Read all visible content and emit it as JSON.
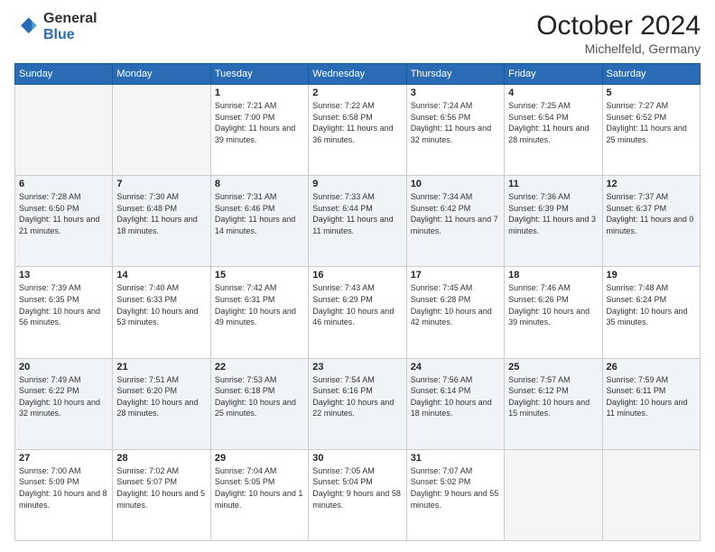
{
  "header": {
    "logo_line1": "General",
    "logo_line2": "Blue",
    "month": "October 2024",
    "location": "Michelfeld, Germany"
  },
  "days_of_week": [
    "Sunday",
    "Monday",
    "Tuesday",
    "Wednesday",
    "Thursday",
    "Friday",
    "Saturday"
  ],
  "weeks": [
    [
      {
        "day": "",
        "empty": true
      },
      {
        "day": "",
        "empty": true
      },
      {
        "day": "1",
        "sunrise": "Sunrise: 7:21 AM",
        "sunset": "Sunset: 7:00 PM",
        "daylight": "Daylight: 11 hours and 39 minutes."
      },
      {
        "day": "2",
        "sunrise": "Sunrise: 7:22 AM",
        "sunset": "Sunset: 6:58 PM",
        "daylight": "Daylight: 11 hours and 36 minutes."
      },
      {
        "day": "3",
        "sunrise": "Sunrise: 7:24 AM",
        "sunset": "Sunset: 6:56 PM",
        "daylight": "Daylight: 11 hours and 32 minutes."
      },
      {
        "day": "4",
        "sunrise": "Sunrise: 7:25 AM",
        "sunset": "Sunset: 6:54 PM",
        "daylight": "Daylight: 11 hours and 28 minutes."
      },
      {
        "day": "5",
        "sunrise": "Sunrise: 7:27 AM",
        "sunset": "Sunset: 6:52 PM",
        "daylight": "Daylight: 11 hours and 25 minutes."
      }
    ],
    [
      {
        "day": "6",
        "sunrise": "Sunrise: 7:28 AM",
        "sunset": "Sunset: 6:50 PM",
        "daylight": "Daylight: 11 hours and 21 minutes."
      },
      {
        "day": "7",
        "sunrise": "Sunrise: 7:30 AM",
        "sunset": "Sunset: 6:48 PM",
        "daylight": "Daylight: 11 hours and 18 minutes."
      },
      {
        "day": "8",
        "sunrise": "Sunrise: 7:31 AM",
        "sunset": "Sunset: 6:46 PM",
        "daylight": "Daylight: 11 hours and 14 minutes."
      },
      {
        "day": "9",
        "sunrise": "Sunrise: 7:33 AM",
        "sunset": "Sunset: 6:44 PM",
        "daylight": "Daylight: 11 hours and 11 minutes."
      },
      {
        "day": "10",
        "sunrise": "Sunrise: 7:34 AM",
        "sunset": "Sunset: 6:42 PM",
        "daylight": "Daylight: 11 hours and 7 minutes."
      },
      {
        "day": "11",
        "sunrise": "Sunrise: 7:36 AM",
        "sunset": "Sunset: 6:39 PM",
        "daylight": "Daylight: 11 hours and 3 minutes."
      },
      {
        "day": "12",
        "sunrise": "Sunrise: 7:37 AM",
        "sunset": "Sunset: 6:37 PM",
        "daylight": "Daylight: 11 hours and 0 minutes."
      }
    ],
    [
      {
        "day": "13",
        "sunrise": "Sunrise: 7:39 AM",
        "sunset": "Sunset: 6:35 PM",
        "daylight": "Daylight: 10 hours and 56 minutes."
      },
      {
        "day": "14",
        "sunrise": "Sunrise: 7:40 AM",
        "sunset": "Sunset: 6:33 PM",
        "daylight": "Daylight: 10 hours and 53 minutes."
      },
      {
        "day": "15",
        "sunrise": "Sunrise: 7:42 AM",
        "sunset": "Sunset: 6:31 PM",
        "daylight": "Daylight: 10 hours and 49 minutes."
      },
      {
        "day": "16",
        "sunrise": "Sunrise: 7:43 AM",
        "sunset": "Sunset: 6:29 PM",
        "daylight": "Daylight: 10 hours and 46 minutes."
      },
      {
        "day": "17",
        "sunrise": "Sunrise: 7:45 AM",
        "sunset": "Sunset: 6:28 PM",
        "daylight": "Daylight: 10 hours and 42 minutes."
      },
      {
        "day": "18",
        "sunrise": "Sunrise: 7:46 AM",
        "sunset": "Sunset: 6:26 PM",
        "daylight": "Daylight: 10 hours and 39 minutes."
      },
      {
        "day": "19",
        "sunrise": "Sunrise: 7:48 AM",
        "sunset": "Sunset: 6:24 PM",
        "daylight": "Daylight: 10 hours and 35 minutes."
      }
    ],
    [
      {
        "day": "20",
        "sunrise": "Sunrise: 7:49 AM",
        "sunset": "Sunset: 6:22 PM",
        "daylight": "Daylight: 10 hours and 32 minutes."
      },
      {
        "day": "21",
        "sunrise": "Sunrise: 7:51 AM",
        "sunset": "Sunset: 6:20 PM",
        "daylight": "Daylight: 10 hours and 28 minutes."
      },
      {
        "day": "22",
        "sunrise": "Sunrise: 7:53 AM",
        "sunset": "Sunset: 6:18 PM",
        "daylight": "Daylight: 10 hours and 25 minutes."
      },
      {
        "day": "23",
        "sunrise": "Sunrise: 7:54 AM",
        "sunset": "Sunset: 6:16 PM",
        "daylight": "Daylight: 10 hours and 22 minutes."
      },
      {
        "day": "24",
        "sunrise": "Sunrise: 7:56 AM",
        "sunset": "Sunset: 6:14 PM",
        "daylight": "Daylight: 10 hours and 18 minutes."
      },
      {
        "day": "25",
        "sunrise": "Sunrise: 7:57 AM",
        "sunset": "Sunset: 6:12 PM",
        "daylight": "Daylight: 10 hours and 15 minutes."
      },
      {
        "day": "26",
        "sunrise": "Sunrise: 7:59 AM",
        "sunset": "Sunset: 6:11 PM",
        "daylight": "Daylight: 10 hours and 11 minutes."
      }
    ],
    [
      {
        "day": "27",
        "sunrise": "Sunrise: 7:00 AM",
        "sunset": "Sunset: 5:09 PM",
        "daylight": "Daylight: 10 hours and 8 minutes."
      },
      {
        "day": "28",
        "sunrise": "Sunrise: 7:02 AM",
        "sunset": "Sunset: 5:07 PM",
        "daylight": "Daylight: 10 hours and 5 minutes."
      },
      {
        "day": "29",
        "sunrise": "Sunrise: 7:04 AM",
        "sunset": "Sunset: 5:05 PM",
        "daylight": "Daylight: 10 hours and 1 minute."
      },
      {
        "day": "30",
        "sunrise": "Sunrise: 7:05 AM",
        "sunset": "Sunset: 5:04 PM",
        "daylight": "Daylight: 9 hours and 58 minutes."
      },
      {
        "day": "31",
        "sunrise": "Sunrise: 7:07 AM",
        "sunset": "Sunset: 5:02 PM",
        "daylight": "Daylight: 9 hours and 55 minutes."
      },
      {
        "day": "",
        "empty": true
      },
      {
        "day": "",
        "empty": true
      }
    ]
  ]
}
